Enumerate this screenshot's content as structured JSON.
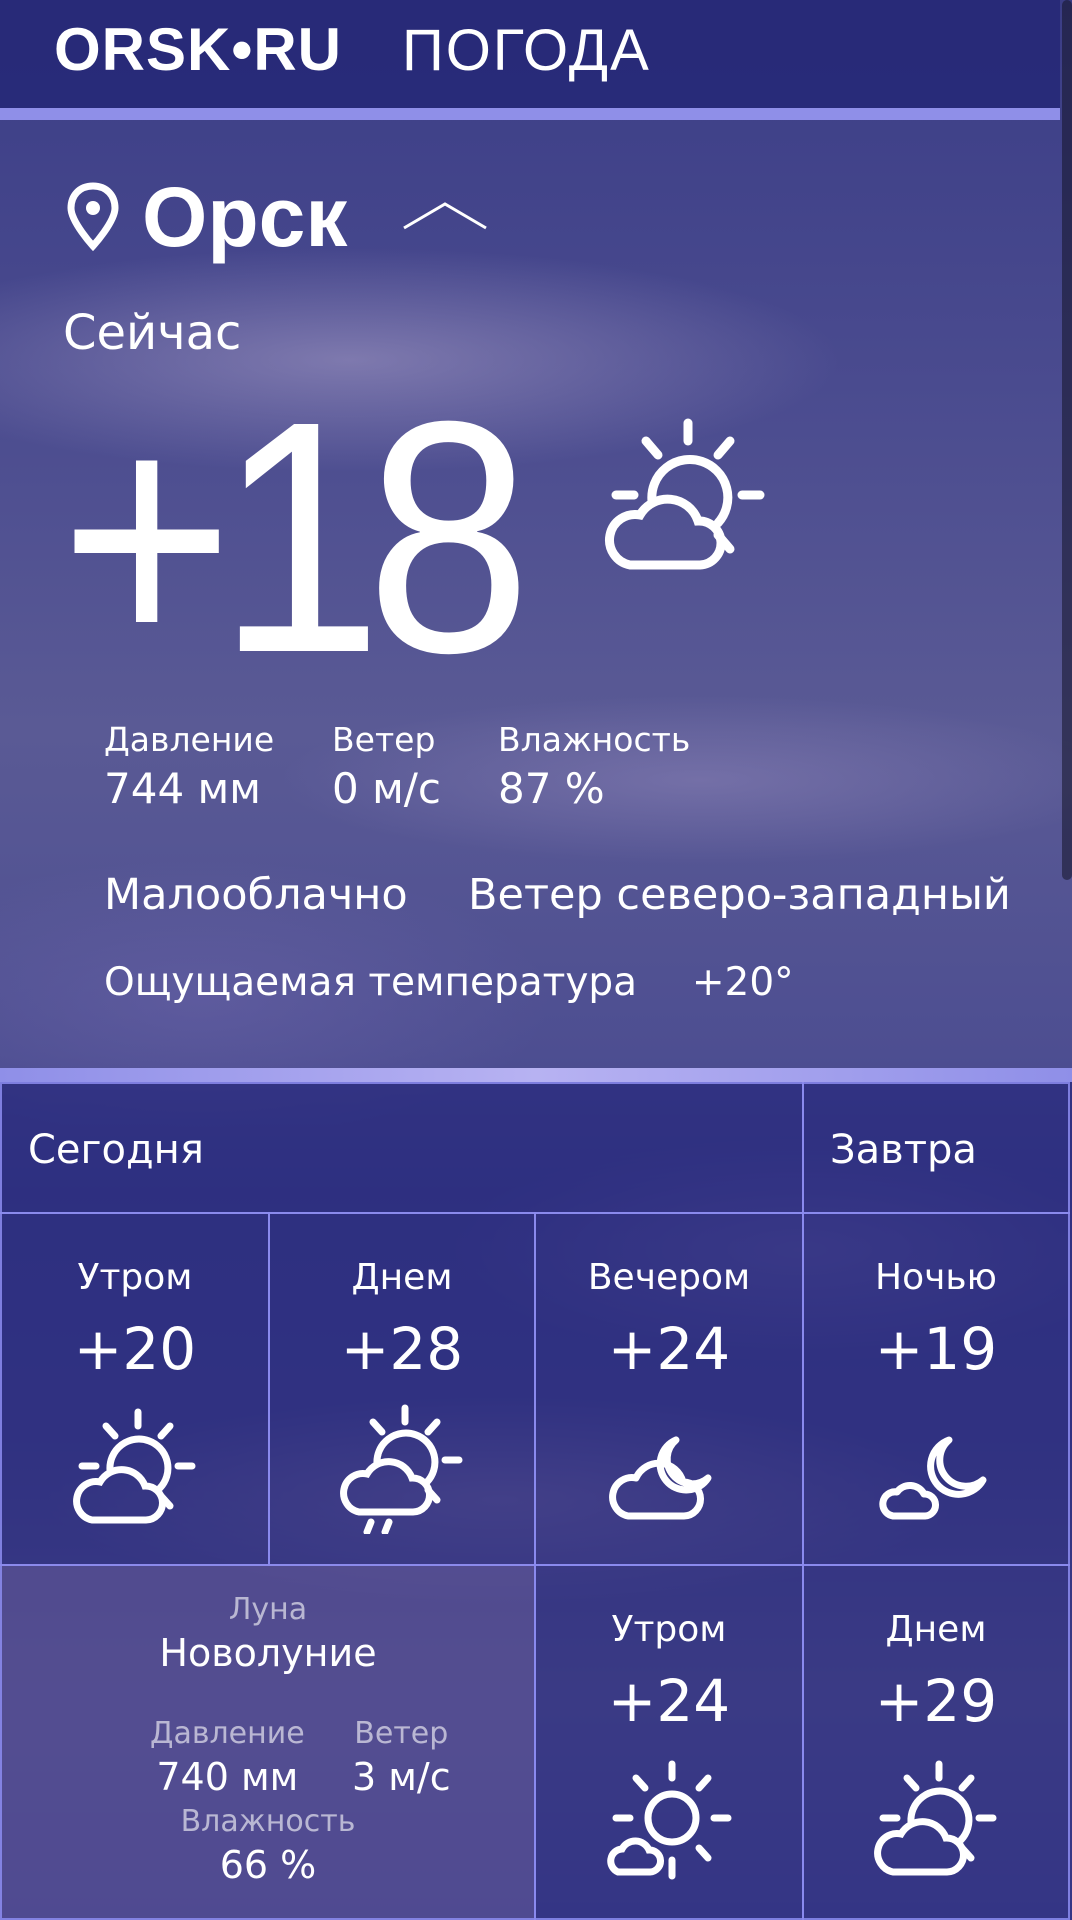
{
  "header": {
    "logo": "ORSK•RU",
    "section": "ПОГОДА"
  },
  "location": {
    "city": "Орск"
  },
  "current": {
    "label": "Сейчас",
    "temperature": "+18",
    "icon": "sun-cloud-icon",
    "metrics": [
      {
        "label": "Давление",
        "value": "744 мм"
      },
      {
        "label": "Ветер",
        "value": "0 м/с"
      },
      {
        "label": "Влажность",
        "value": "87 %"
      }
    ],
    "condition": "Малооблачно",
    "wind_direction": "Ветер северо-западный",
    "feels_like_label": "Ощущаемая температура",
    "feels_like_value": "+20°"
  },
  "forecast": {
    "today_label": "Сегодня",
    "tomorrow_label": "Завтра",
    "today": [
      {
        "period": "Утром",
        "temp": "+20",
        "icon": "sun-cloud-icon"
      },
      {
        "period": "Днем",
        "temp": "+28",
        "icon": "sun-cloud-rain-icon"
      },
      {
        "period": "Вечером",
        "temp": "+24",
        "icon": "moon-cloud-icon"
      },
      {
        "period": "Ночью",
        "temp": "+19",
        "icon": "moon-small-cloud-icon"
      }
    ],
    "details": {
      "moon_label": "Луна",
      "moon_phase": "Новолуние",
      "pressure_label": "Давление",
      "pressure_value": "740 мм",
      "wind_label": "Ветер",
      "wind_value": "3 м/с",
      "humidity_label": "Влажность",
      "humidity_value": "66 %"
    },
    "tomorrow": [
      {
        "period": "Утром",
        "temp": "+24",
        "icon": "sun-small-cloud-icon"
      },
      {
        "period": "Днем",
        "temp": "+29",
        "icon": "sun-cloud-icon"
      }
    ]
  }
}
